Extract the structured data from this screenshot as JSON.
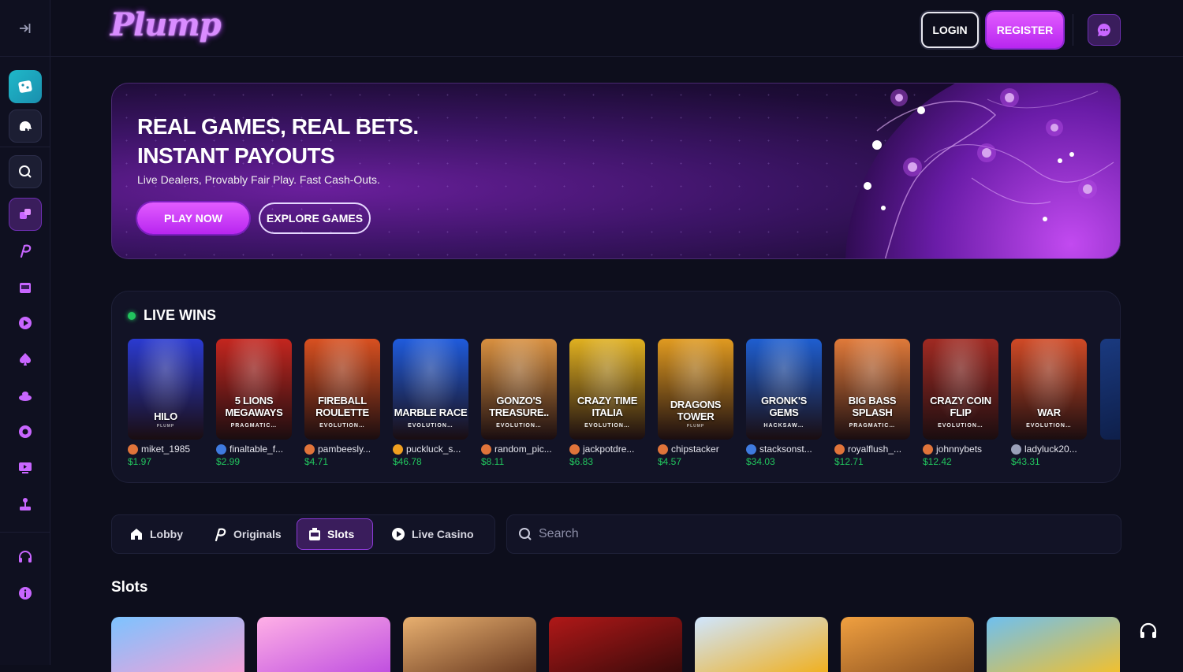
{
  "header": {
    "logo": "Plump",
    "login_label": "LOGIN",
    "register_label": "REGISTER",
    "chat_icon": "chat-bubble-icon"
  },
  "sidebar": {
    "collapse_icon": "collapse-arrow-icon",
    "items": [
      {
        "name": "casino",
        "icon": "dice-logo-icon"
      },
      {
        "name": "sports",
        "icon": "football-helmet-icon"
      },
      {
        "name": "search",
        "icon": "search-icon"
      },
      {
        "name": "casino-games",
        "icon": "dice-icon"
      },
      {
        "name": "originals",
        "icon": "plump-p-icon"
      },
      {
        "name": "slots",
        "icon": "slot-machine-icon"
      },
      {
        "name": "live-casino",
        "icon": "play-icon"
      },
      {
        "name": "poker",
        "icon": "spade-icon"
      },
      {
        "name": "game-shows",
        "icon": "stage-icon"
      },
      {
        "name": "roulette",
        "icon": "roulette-icon"
      },
      {
        "name": "video",
        "icon": "tv-play-icon"
      },
      {
        "name": "arcade",
        "icon": "joystick-icon"
      },
      {
        "name": "support",
        "icon": "headset-icon"
      },
      {
        "name": "info",
        "icon": "info-icon"
      }
    ]
  },
  "hero": {
    "title_line1": "REAL GAMES, REAL BETS.",
    "title_line2": "INSTANT PAYOUTS",
    "subtitle": "Live Dealers, Provably Fair Play. Fast Cash-Outs.",
    "play_label": "PLAY NOW",
    "explore_label": "EXPLORE GAMES"
  },
  "live_wins": {
    "title": "LIVE WINS",
    "items": [
      {
        "game": "HILO",
        "provider": "PLUMP",
        "user": "miket_1985",
        "amount": "$1.97",
        "bg": "#2a3ad0",
        "avatar": "#e0743a"
      },
      {
        "game": "5 LIONS MEGAWAYS",
        "provider": "PRAGMATIC…",
        "user": "finaltable_f...",
        "amount": "$2.99",
        "bg": "#c4261f",
        "avatar": "#3f7be0"
      },
      {
        "game": "FIREBALL ROULETTE",
        "provider": "EVOLUTION…",
        "user": "pambeesly...",
        "amount": "$4.71",
        "bg": "#d85020",
        "avatar": "#e0743a"
      },
      {
        "game": "MARBLE RACE",
        "provider": "EVOLUTION…",
        "user": "puckluck_s...",
        "amount": "$46.78",
        "bg": "#1f5bdc",
        "avatar": "#f0a020"
      },
      {
        "game": "GONZO'S TREASURE..",
        "provider": "EVOLUTION…",
        "user": "random_pic...",
        "amount": "$8.11",
        "bg": "#d89040",
        "avatar": "#e0743a"
      },
      {
        "game": "CRAZY TIME ITALIA",
        "provider": "EVOLUTION…",
        "user": "jackpotdre...",
        "amount": "$6.83",
        "bg": "#e0b020",
        "avatar": "#e0743a"
      },
      {
        "game": "DRAGONS TOWER",
        "provider": "PLUMP",
        "user": "chipstacker",
        "amount": "$4.57",
        "bg": "#e09a20",
        "avatar": "#e0743a"
      },
      {
        "game": "GRONK'S GEMS",
        "provider": "HACKSAW…",
        "user": "stacksonst...",
        "amount": "$34.03",
        "bg": "#1e5ed0",
        "avatar": "#3f7be0"
      },
      {
        "game": "BIG BASS SPLASH",
        "provider": "PRAGMATIC…",
        "user": "royalflush_...",
        "amount": "$12.71",
        "bg": "#e07a3a",
        "avatar": "#e0743a"
      },
      {
        "game": "CRAZY COIN FLIP",
        "provider": "EVOLUTION…",
        "user": "johnnybets",
        "amount": "$12.42",
        "bg": "#a02a22",
        "avatar": "#e0743a"
      },
      {
        "game": "WAR",
        "provider": "EVOLUTION…",
        "user": "ladyluck20...",
        "amount": "$43.31",
        "bg": "#d04a26",
        "avatar": "#9aa0b8"
      }
    ]
  },
  "tabs": [
    {
      "label": "Lobby",
      "icon": "home-icon",
      "active": false
    },
    {
      "label": "Originals",
      "icon": "plump-p-icon",
      "active": false
    },
    {
      "label": "Slots",
      "icon": "slot-machine-icon",
      "active": true
    },
    {
      "label": "Live Casino",
      "icon": "play-circle-icon",
      "active": false
    }
  ],
  "search": {
    "placeholder": "Search"
  },
  "slots": {
    "title": "Slots",
    "tiles": [
      {
        "name": "slot-tile-1",
        "colors": [
          "#7cc3ff",
          "#f5a0d8"
        ]
      },
      {
        "name": "slot-tile-2",
        "colors": [
          "#ffb0e6",
          "#c050e0"
        ]
      },
      {
        "name": "slot-tile-3",
        "colors": [
          "#e8b070",
          "#6a3a20"
        ]
      },
      {
        "name": "slot-tile-4",
        "colors": [
          "#b01818",
          "#3a0a0a"
        ]
      },
      {
        "name": "slot-tile-5",
        "colors": [
          "#cfe6ff",
          "#f0b020"
        ]
      },
      {
        "name": "slot-tile-6",
        "colors": [
          "#f0a040",
          "#8a5020"
        ]
      },
      {
        "name": "slot-tile-7",
        "colors": [
          "#6ec0f0",
          "#f0c030"
        ]
      }
    ]
  },
  "colors": {
    "accent": "#c43cf5",
    "win_green": "#22c55e",
    "bg": "#0d0e1c"
  }
}
